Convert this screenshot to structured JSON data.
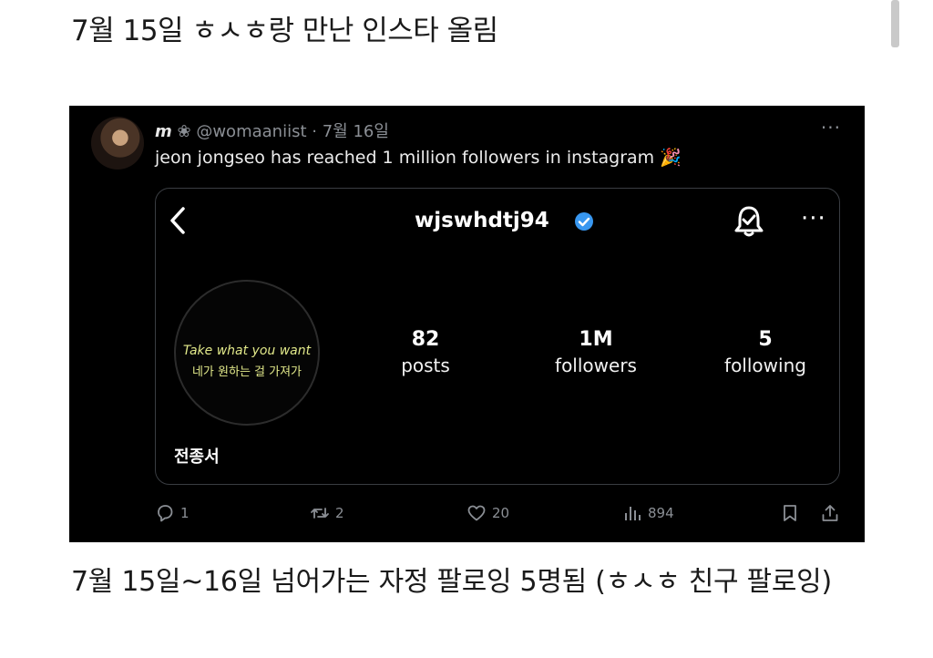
{
  "heading": "7월 15일 ㅎㅅㅎ랑 만난 인스타 올림",
  "tweet": {
    "display_name": "m",
    "handle": "@womaaniist",
    "separator": "·",
    "date": "7월 16일",
    "more": "···",
    "text": "jeon jongseo has reached 1 million followers in instagram 🎉",
    "actions": {
      "replies": "1",
      "retweets": "2",
      "likes": "20",
      "views": "894"
    }
  },
  "instagram": {
    "username": "wjswhdtj94",
    "more": "···",
    "profile_pic_text_en": "Take what you want",
    "profile_pic_text_ko": "네가 원하는 걸 가져가",
    "stats": [
      {
        "value": "82",
        "label": "posts"
      },
      {
        "value": "1M",
        "label": "followers"
      },
      {
        "value": "5",
        "label": "following"
      }
    ],
    "name": "전종서"
  },
  "caption": "7월 15일~16일 넘어가는 자정 팔로잉 5명됨 (ㅎㅅㅎ 친구 팔로잉)",
  "colors": {
    "verified": "#3897f0",
    "muted": "#8b8f95",
    "pic_text": "#e2e98a"
  }
}
